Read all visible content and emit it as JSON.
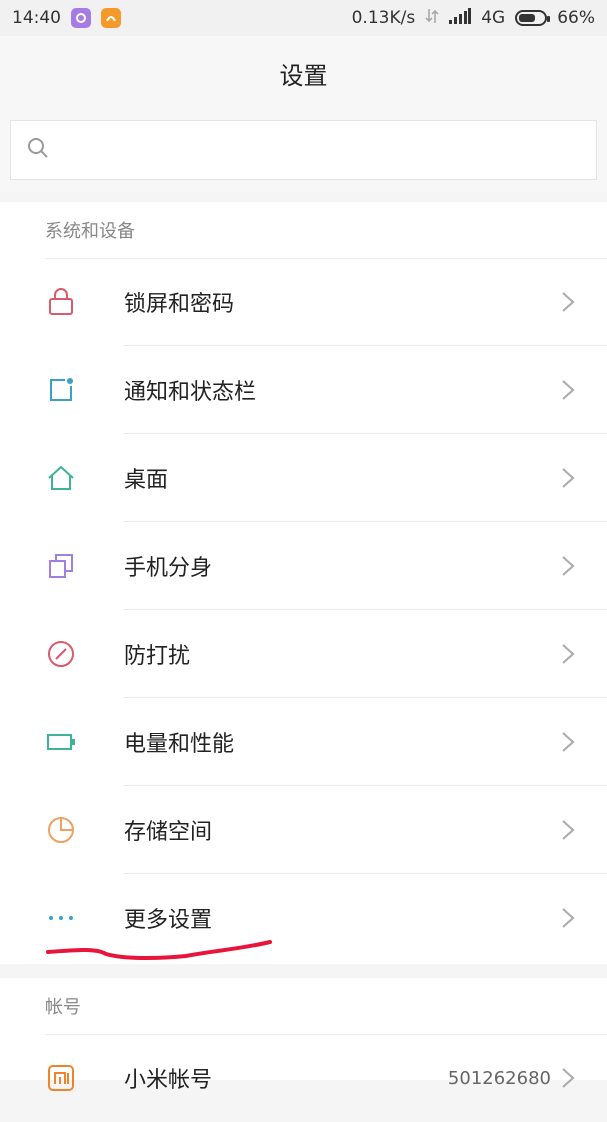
{
  "status_bar": {
    "time": "14:40",
    "net_speed": "0.13K/s",
    "network": "4G",
    "battery_percent": "66%",
    "battery_level": 0.66
  },
  "title": "设置",
  "search": {
    "placeholder": ""
  },
  "sections": [
    {
      "header": "系统和设备",
      "items": [
        {
          "label": "锁屏和密码",
          "icon": "lock-icon"
        },
        {
          "label": "通知和状态栏",
          "icon": "notification-icon"
        },
        {
          "label": "桌面",
          "icon": "home-icon"
        },
        {
          "label": "手机分身",
          "icon": "clone-icon"
        },
        {
          "label": "防打扰",
          "icon": "do-not-disturb-icon"
        },
        {
          "label": "电量和性能",
          "icon": "battery-icon"
        },
        {
          "label": "存储空间",
          "icon": "storage-icon"
        },
        {
          "label": "更多设置",
          "icon": "more-icon"
        }
      ]
    },
    {
      "header": "帐号",
      "items": [
        {
          "label": "小米帐号",
          "value": "501262680",
          "icon": "mi-logo-icon"
        }
      ]
    }
  ],
  "colors": {
    "lock": "#d95a6a",
    "notification": "#3aa0c8",
    "home": "#3fb39a",
    "clone": "#a07fe0",
    "dnd": "#d95a6a",
    "battery": "#3fb39a",
    "storage": "#f0a060",
    "more": "#3aa0c8",
    "mi": "#f0832a",
    "annotation": "#e8143c"
  }
}
